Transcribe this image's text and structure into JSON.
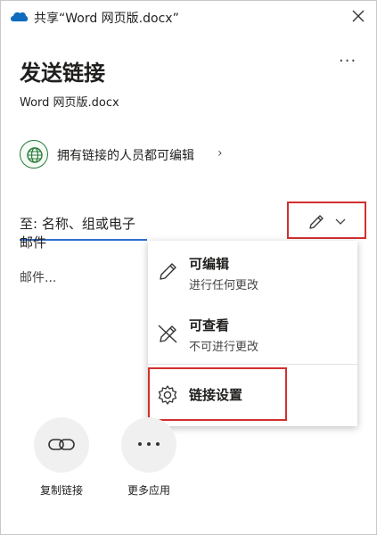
{
  "window": {
    "title": "共享“Word 网页版.docx”"
  },
  "header": {
    "heading": "发送链接",
    "filename": "Word 网页版.docx",
    "more_label": "···"
  },
  "permission": {
    "text": "拥有链接的人员都可编辑",
    "chevron": "›"
  },
  "to_field": {
    "placeholder": "至: 名称、组或电子邮件"
  },
  "message": {
    "placeholder": "邮件..."
  },
  "menu": {
    "items": [
      {
        "title": "可编辑",
        "subtitle": "进行任何更改",
        "icon": "pencil-icon"
      },
      {
        "title": "可查看",
        "subtitle": "不可进行更改",
        "icon": "no-edit-icon"
      },
      {
        "title": "链接设置",
        "subtitle": "",
        "icon": "gear-icon"
      }
    ]
  },
  "share_options": [
    {
      "label": "复制链接",
      "icon": "link-icon"
    },
    {
      "label": "更多应用",
      "icon": "more-icon"
    }
  ],
  "colors": {
    "accent": "#2f6fd0",
    "highlight": "#d32f2f",
    "globe": "#2a7a3a"
  }
}
